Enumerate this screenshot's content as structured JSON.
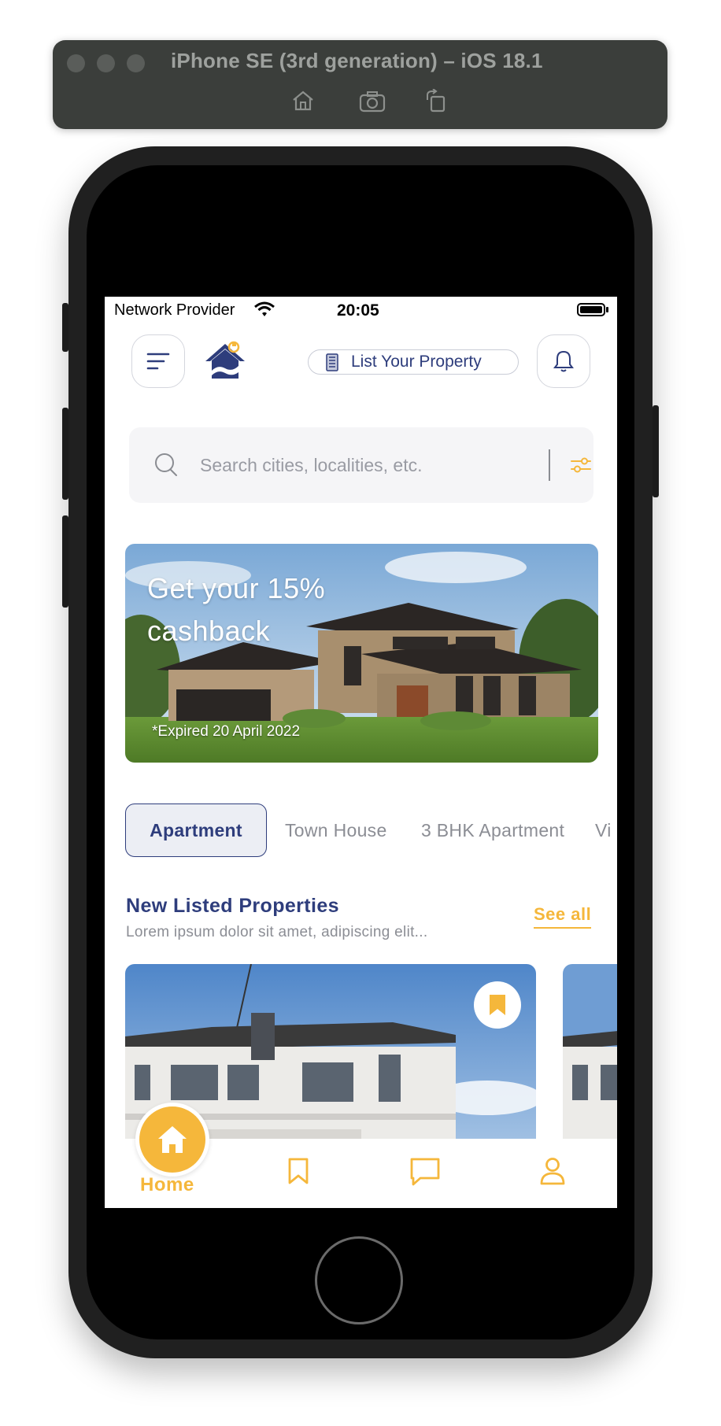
{
  "simulator": {
    "title": "iPhone SE (3rd generation) – iOS 18.1",
    "toolbar_icons": [
      "home-icon",
      "screenshot-icon",
      "rotate-icon"
    ]
  },
  "status_bar": {
    "carrier": "Network Provider",
    "time": "20:05"
  },
  "header": {
    "menu_icon": "menu-icon",
    "logo": "house-logo",
    "list_property_label": "List Your Property",
    "notification_icon": "bell-icon"
  },
  "search": {
    "placeholder": "Search cities, localities, etc.",
    "value": ""
  },
  "banner": {
    "title": "Get your 15% cashback",
    "note": "*Expired 20 April 2022"
  },
  "categories": {
    "items": [
      "Apartment",
      "Town House",
      "3 BHK Apartment",
      "Vi"
    ],
    "selected": "Apartment"
  },
  "section": {
    "title": "New Listed Properties",
    "subtitle": "Lorem ipsum dolor sit amet,  adipiscing elit...",
    "see_all": "See all"
  },
  "tab_bar": {
    "home_label": "Home",
    "icons": [
      "home-icon",
      "bookmark-icon",
      "chat-icon",
      "profile-icon"
    ]
  },
  "colors": {
    "primary": "#2e3d7c",
    "accent": "#f5b73b",
    "muted": "#8b8d94"
  }
}
